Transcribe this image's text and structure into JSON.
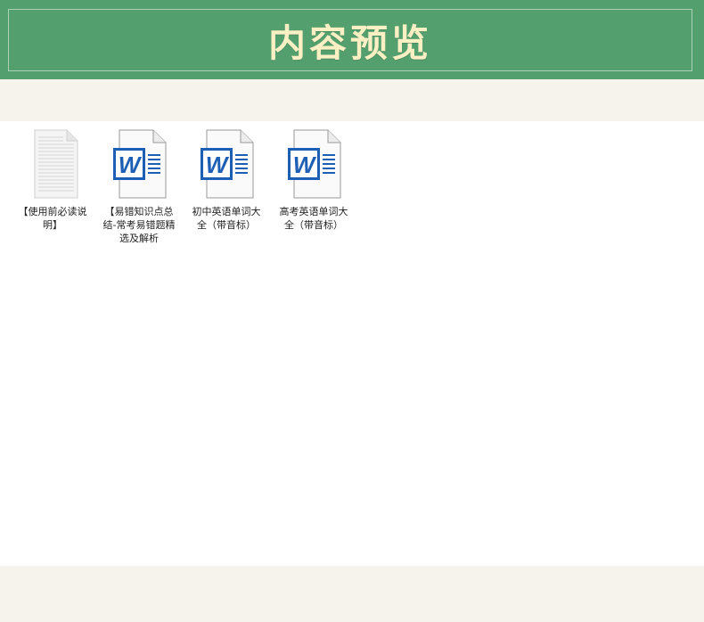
{
  "header": {
    "title": "内容预览"
  },
  "files": [
    {
      "label": "【使用前必读说明】",
      "icon": "text-document-icon"
    },
    {
      "label": "【易错知识点总结-常考易错题精选及解析",
      "icon": "word-document-icon"
    },
    {
      "label": "初中英语单词大全（带音标）",
      "icon": "word-document-icon"
    },
    {
      "label": "高考英语单词大全（带音标）",
      "icon": "word-document-icon"
    }
  ],
  "colors": {
    "header_bg": "#549f6e",
    "title_text": "#fbf0c4",
    "page_bg": "#f6f3ec",
    "word_blue": "#1d5fb4"
  }
}
